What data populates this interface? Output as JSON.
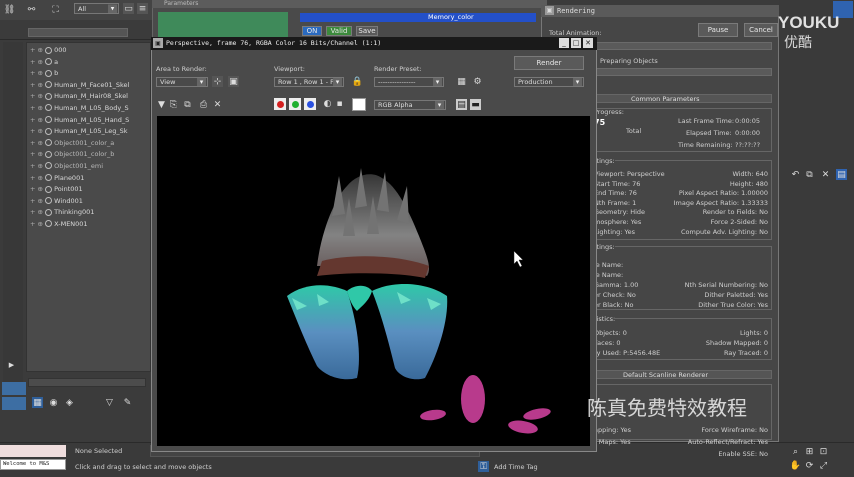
{
  "left_toolbar": {
    "icons": [
      "link-icon",
      "unlink-icon",
      "bind-icon"
    ]
  },
  "selection_filter": "All",
  "scene_tree": {
    "items": [
      "000",
      "a",
      "b",
      "Human_M_Face01_Skel",
      "Human_M_Hair08_Skel",
      "Human_M_L05_Body_S",
      "Human_M_L05_Hand_S",
      "Human_M_L05_Leg_Sk",
      "Object001_color_a",
      "Object001_color_b",
      "Object001_emi",
      "Plane001",
      "Point001",
      "Wind001",
      "Thinking001",
      "X-MEN001"
    ]
  },
  "status": {
    "maxscript_label": "Welcome to M&S",
    "selection": "None Selected",
    "prompt": "Click and drag to select and move objects",
    "add_time_tag": "Add Time Tag"
  },
  "behind_window": {
    "title_fragment": "Parameters",
    "field_title": "Memory_color",
    "chips": [
      "ON",
      "Valid",
      "Save"
    ]
  },
  "frame_window": {
    "title": "Perspective, frame 76, RGBA Color 16 Bits/Channel (1:1)",
    "area_label": "Area to Render:",
    "area_value": "View",
    "viewport_label": "Viewport:",
    "viewport_value": "Row 1 , Row 1 - P",
    "preset_label": "Render Preset:",
    "preset_value": "----------------",
    "render_button": "Render",
    "production_value": "Production",
    "channel_value": "RGB Alpha",
    "color_swatches": [
      "#d42020",
      "#20b030",
      "#2a50e0"
    ]
  },
  "rendering": {
    "title": "Rendering",
    "pause": "Pause",
    "cancel": "Cancel",
    "total_animation": "Total Animation:",
    "preparing": "Preparing Objects",
    "common_parameters": "Common Parameters",
    "progress": "Progress:",
    "frame_num": "75",
    "total": "Total",
    "last_frame_time_label": "Last Frame Time:",
    "last_frame_time": "0:00:05",
    "elapsed_time_label": "Elapsed Time:",
    "elapsed_time": "0:00:00",
    "time_remaining_label": "Time Remaining:",
    "time_remaining": "??:??:??",
    "settings_title": "ttings:",
    "left_settings": [
      "Viewport: Perspective",
      "Start Time: 76",
      "End Time: 76",
      "Nth Frame: 1",
      "Geometry: Hide",
      "mosphere: Yes",
      "Lighting: Yes"
    ],
    "right_settings": [
      "Width: 640",
      "Height: 480",
      "Pixel Aspect Ratio: 1.00000",
      "Image Aspect Ratio: 1.33333",
      "Render to Fields: No",
      "Force 2-Sided: No",
      "Compute Adv. Lighting: No"
    ],
    "output_title": "ttings:",
    "output_left": [
      "le Name:",
      "le Name:",
      "Gamma: 1.00",
      "er Check: No",
      "er Black: No"
    ],
    "output_right": [
      "Nth Serial Numbering: No",
      "Dither Paletted: Yes",
      "Dither True Color: Yes"
    ],
    "stats_title": "tistics:",
    "stats_left": [
      "Objects: 0",
      "Faces: 0",
      "ry Used: P:5456.48E"
    ],
    "stats_right": [
      "Lights: 0",
      "Shadow Mapped: 0",
      "Ray Traced: 0"
    ],
    "scanline_title": "Default Scanline Renderer",
    "scan_left": [
      "apping: Yes",
      "r Maps: Yes"
    ],
    "scan_right": [
      "Force Wireframe: No",
      "Auto-Reflect/Refract: Yes",
      "Enable SSE: No"
    ]
  },
  "watermark": {
    "logo_text": "YOUKU",
    "logo_sub": "优酷",
    "caption": "陈真免费特效教程"
  }
}
